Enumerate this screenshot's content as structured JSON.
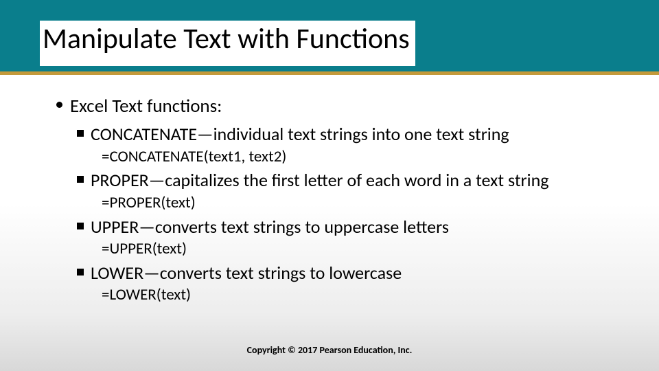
{
  "title": "Manipulate Text with Functions",
  "intro": "Excel Text functions:",
  "items": [
    {
      "heading": "CONCATENATE—individual text strings into one text string",
      "syntax": "=CONCATENATE(text1, text2)"
    },
    {
      "heading": "PROPER—capitalizes the first letter of each word in a text string",
      "syntax": "=PROPER(text)"
    },
    {
      "heading": "UPPER—converts text strings to uppercase letters",
      "syntax": "=UPPER(text)"
    },
    {
      "heading": "LOWER—converts text strings to lowercase",
      "syntax": "=LOWER(text)"
    }
  ],
  "footer": "Copyright © 2017 Pearson Education, Inc."
}
